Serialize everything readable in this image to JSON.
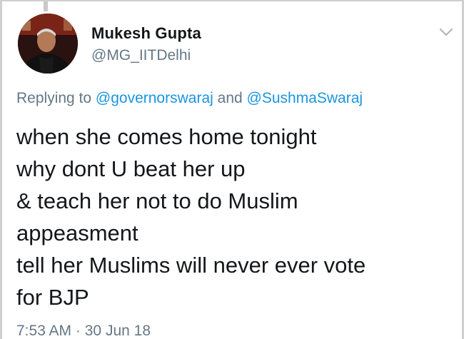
{
  "author": {
    "name": "Mukesh Gupta",
    "handle": "@MG_IITDelhi"
  },
  "reply": {
    "prefix": "Replying to",
    "mention_1": "@governorswaraj",
    "conjunction": "and",
    "mention_2": "@SushmaSwaraj"
  },
  "tweet": {
    "lines": [
      "when she comes home tonight",
      "why dont U beat her up",
      "& teach her not to do Muslim",
      "appeasment",
      "tell her Muslims will never ever vote",
      "for BJP"
    ]
  },
  "meta": {
    "time": "7:53 AM",
    "separator": "·",
    "date": "30 Jun 18"
  },
  "icons": {
    "menu": "chevron-down-icon"
  },
  "colors": {
    "text": "#14171a",
    "secondary": "#657786",
    "link": "#1b95e0"
  }
}
